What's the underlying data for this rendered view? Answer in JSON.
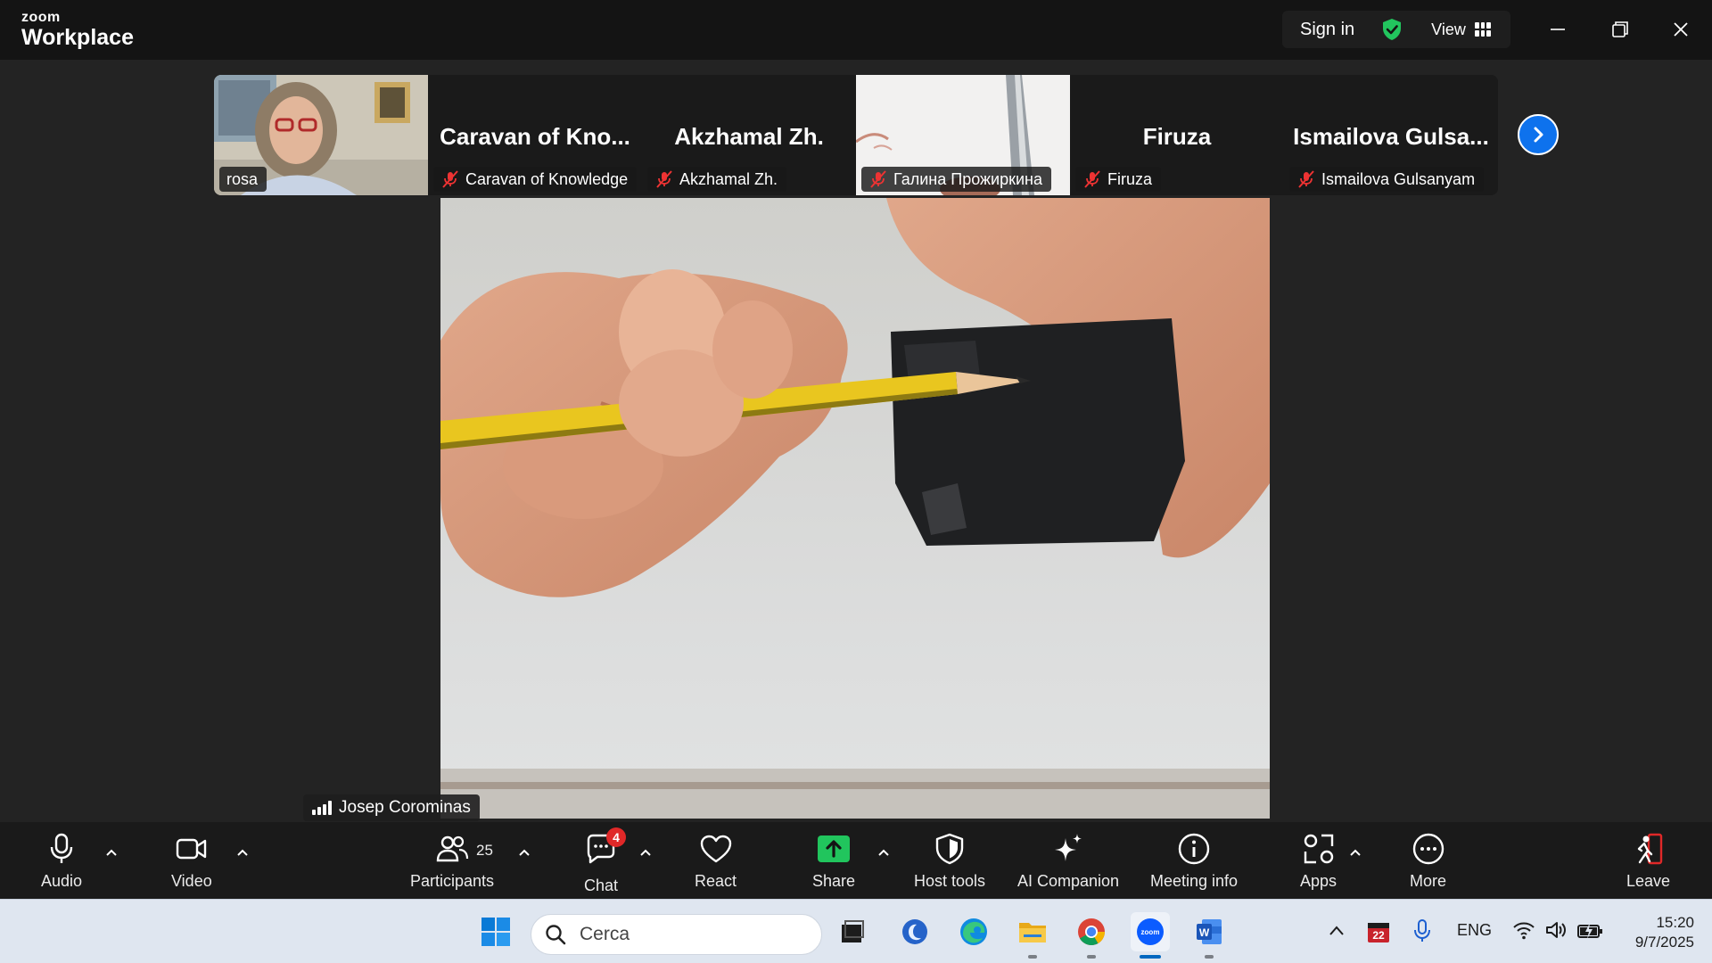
{
  "window": {
    "brand_small": "zoom",
    "brand_big": "Workplace",
    "sign_in": "Sign in",
    "view": "View"
  },
  "gallery": {
    "tiles": [
      {
        "display_name": "",
        "label": "rosa",
        "muted": false,
        "has_video": true
      },
      {
        "display_name": "Caravan of Kno...",
        "label": "Caravan of Knowledge",
        "muted": true,
        "has_video": false
      },
      {
        "display_name": "Akzhamal Zh.",
        "label": "Akzhamal Zh.",
        "muted": true,
        "has_video": false
      },
      {
        "display_name": "",
        "label": "Галина Прожиркина",
        "muted": true,
        "has_video": true
      },
      {
        "display_name": "Firuza",
        "label": "Firuza",
        "muted": true,
        "has_video": false
      },
      {
        "display_name": "Ismailova Gulsa...",
        "label": "Ismailova Gulsanyam",
        "muted": true,
        "has_video": false
      }
    ]
  },
  "main_video": {
    "speaker": "Josep Corominas"
  },
  "toolbar": {
    "audio": "Audio",
    "video": "Video",
    "participants": "Participants",
    "participants_count": "25",
    "chat": "Chat",
    "chat_badge": "4",
    "react": "React",
    "share": "Share",
    "host_tools": "Host tools",
    "ai_companion": "AI Companion",
    "meeting_info": "Meeting info",
    "apps": "Apps",
    "more": "More",
    "leave": "Leave"
  },
  "taskbar": {
    "search_placeholder": "Cerca",
    "language": "ENG",
    "calendar_day": "22",
    "time": "15:20",
    "date": "9/7/2025"
  },
  "colors": {
    "accent_blue": "#0e72ed",
    "share_green": "#21c55d",
    "badge_red": "#e02828",
    "shield_green": "#22c55e"
  }
}
